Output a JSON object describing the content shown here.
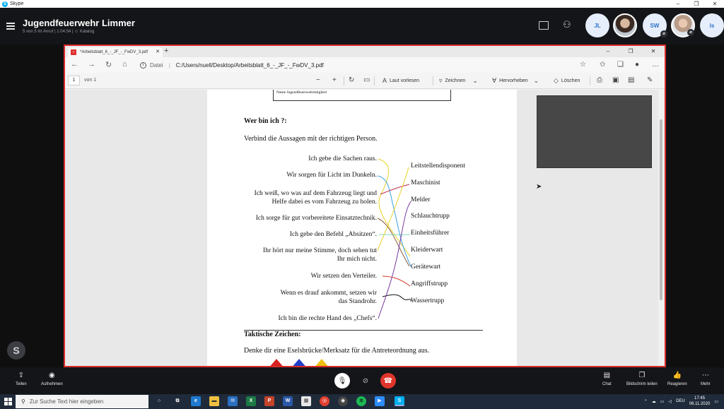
{
  "skype": {
    "app_name": "Skype",
    "call_title": "Jugendfeuerwehr Limmer",
    "call_subtitle": "5 von 5 im Anruf | 1:04:54 | ☺ Katalog",
    "participants": [
      {
        "initials": "JL"
      },
      {
        "initials": ""
      },
      {
        "initials": "SW"
      },
      {
        "initials": ""
      },
      {
        "initials": "ls"
      }
    ],
    "side_logo": "S"
  },
  "browser": {
    "tab_title": "*Arbeitsblatt_6_-_JF_-_FwDV_3.pdf",
    "address_scheme": "Datei",
    "address_path": "C:/Users/nuell/Desktop/Arbeitsblatt_6_-_JF_-_FwDV_3.pdf"
  },
  "pdf_toolbar": {
    "page_current": "1",
    "page_of": "von 1",
    "read_aloud": "Laut vorlesen",
    "draw": "Zeichnen",
    "highlight": "Hervorheben",
    "erase": "Löschen"
  },
  "worksheet": {
    "name_box_label": "Name Jugendfeuerwehrmitglied",
    "heading": "Wer bin ich ?:",
    "instruction": "Verbind die Aussagen mit der richtigen Person.",
    "statements": [
      "Ich gebe die Sachen raus.",
      "Wir sorgen für Licht im Dunkeln.",
      "Ich weiß, wo was auf dem Fahrzeug liegt und",
      "Helfe dabei es vom Fahrzeug zu holen.",
      "Ich sorge für gut vorbereitete Einsatztechnik.",
      "Ich gebe den Befehl „Absitzen“.",
      "Ihr hört nur meine Stimme, doch sehen tut",
      "Ihr mich nicht.",
      "Wir setzen den Verteiler.",
      "Wenn es drauf ankommt, setzen wir",
      "das Standrohr.",
      "Ich bin die rechte Hand des „Chefs“."
    ],
    "roles": [
      "Leitstellendisponent",
      "Maschinist",
      "Melder",
      "Schlauchtrupp",
      "Einheitsführer",
      "Kleiderwart",
      "Gerätewart",
      "Angriffstrupp",
      "Wassertrupp"
    ],
    "tactical_heading": "Taktische Zeichen:",
    "mnemonic": "Denke dir eine Eselsbrücke/Merksatz für die Antreteordnung aus."
  },
  "call_controls": {
    "share": "Teilen",
    "record": "Aufnehmen",
    "chat": "Chat",
    "share_screen": "Bildschirm teilen",
    "react": "Reagieren",
    "more": "Mehr"
  },
  "taskbar": {
    "search_placeholder": "Zur Suche Text hier eingeben",
    "language": "DEU",
    "time": "17:45",
    "date": "06.11.2020"
  },
  "colors": {
    "share_border": "#d92b2b",
    "hangup": "#e0352b",
    "accent": "#2c73c8"
  }
}
